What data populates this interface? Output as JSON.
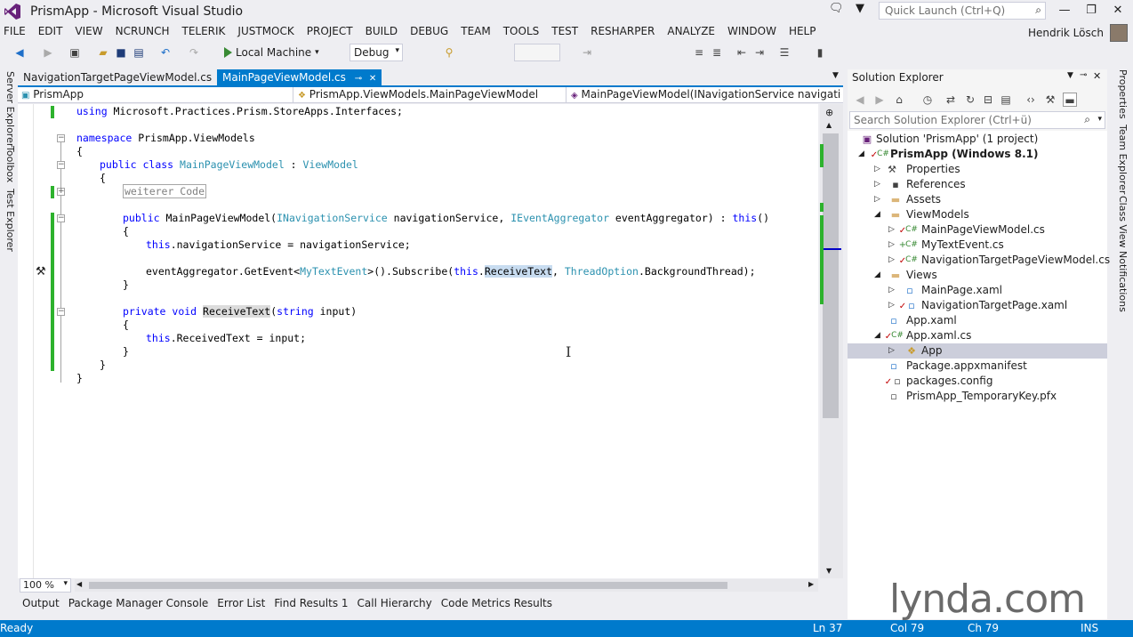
{
  "window": {
    "title": "PrismApp - Microsoft Visual Studio",
    "quick_launch_placeholder": "Quick Launch (Ctrl+Q)",
    "user_name": "Hendrik Lösch"
  },
  "menu": [
    "FILE",
    "EDIT",
    "VIEW",
    "NCRUNCH",
    "TELERIK",
    "JUSTMOCK",
    "PROJECT",
    "BUILD",
    "DEBUG",
    "TEAM",
    "TOOLS",
    "TEST",
    "RESHARPER",
    "ANALYZE",
    "WINDOW",
    "HELP"
  ],
  "toolbar": {
    "run_label": "Local Machine",
    "configuration": "Debug"
  },
  "left_rail": [
    "Server Explorer",
    "Toolbox",
    "Test Explorer"
  ],
  "right_rail": [
    "Properties",
    "Team Explorer",
    "Class View",
    "Notifications"
  ],
  "doc_tabs": [
    {
      "label": "NavigationTargetPageViewModel.cs"
    },
    {
      "label": "MainPageViewModel.cs"
    }
  ],
  "navbar": {
    "project": "PrismApp",
    "class": "PrismApp.ViewModels.MainPageViewModel",
    "member": "MainPageViewModel(INavigationService navigationSen"
  },
  "code": {
    "l1_kw": "using",
    "l1_rest": " Microsoft.Practices.Prism.StoreApps.Interfaces;",
    "l2_kw": "namespace",
    "l2_rest": " PrismApp.ViewModels",
    "brace_open": "{",
    "brace_close": "}",
    "l4_kw1": "public",
    "l4_kw2": "class",
    "l4_type": "MainPageViewModel",
    "l4_colon": " : ",
    "l4_base": "ViewModel",
    "collapsed": "weiterer Code",
    "l7_kw": "public",
    "l7_name": " MainPageViewModel(",
    "l7_t1": "INavigationService",
    "l7_p1": " navigationService, ",
    "l7_t2": "IEventAggregator",
    "l7_p2": " eventAggregator) : ",
    "l7_this": "this",
    "l7_end": "()",
    "l9_this": "this",
    "l9_rest": ".navigationService = navigationService;",
    "l11_a": "eventAggregator.GetEvent<",
    "l11_t": "MyTextEvent",
    "l11_b": ">().Subscribe(",
    "l11_this": "this",
    "l11_dot": ".",
    "l11_m": "ReceiveText",
    "l11_c": ", ",
    "l11_t2": "ThreadOption",
    "l11_d": ".BackgroundThread);",
    "l13_kw1": "private",
    "l13_kw2": "void",
    "l13_m": "ReceiveText",
    "l13_p": "(",
    "l13_kw3": "string",
    "l13_end": " input)",
    "l15_this": "this",
    "l15_rest": ".ReceivedText = input;"
  },
  "editor": {
    "zoom": "100 %"
  },
  "bottom_tabs": [
    "Output",
    "Package Manager Console",
    "Error List",
    "Find Results 1",
    "Call Hierarchy",
    "Code Metrics Results"
  ],
  "status": {
    "state": "Ready",
    "line": "Ln 37",
    "col": "Col 79",
    "ch": "Ch 79",
    "mode": "INS"
  },
  "solution_explorer": {
    "title": "Solution Explorer",
    "search_placeholder": "Search Solution Explorer (Ctrl+ü)",
    "items": [
      {
        "label": "Solution 'PrismApp' (1 project)"
      },
      {
        "label": "PrismApp (Windows 8.1)"
      },
      {
        "label": "Properties"
      },
      {
        "label": "References"
      },
      {
        "label": "Assets"
      },
      {
        "label": "ViewModels"
      },
      {
        "label": "MainPageViewModel.cs"
      },
      {
        "label": "MyTextEvent.cs"
      },
      {
        "label": "NavigationTargetPageViewModel.cs"
      },
      {
        "label": "Views"
      },
      {
        "label": "MainPage.xaml"
      },
      {
        "label": "NavigationTargetPage.xaml"
      },
      {
        "label": "App.xaml"
      },
      {
        "label": "App.xaml.cs"
      },
      {
        "label": "App"
      },
      {
        "label": "Package.appxmanifest"
      },
      {
        "label": "packages.config"
      },
      {
        "label": "PrismApp_TemporaryKey.pfx"
      }
    ]
  },
  "watermark": "lynda.com",
  "colors": {
    "accent": "#007ACC",
    "keyword": "#0000FF",
    "type": "#2B91AF",
    "change_bar": "#2DB22D"
  }
}
